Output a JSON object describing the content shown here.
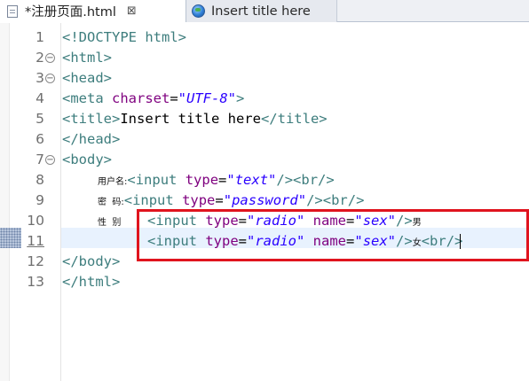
{
  "tabs": [
    {
      "label": "*注册页面.html",
      "close": "⊠",
      "icon": "file-icon",
      "active": true
    },
    {
      "label": "Insert title here",
      "icon": "globe-icon",
      "active": false
    }
  ],
  "editor": {
    "line_numbers": [
      "1",
      "2",
      "3",
      "4",
      "5",
      "6",
      "7",
      "8",
      "9",
      "10",
      "11",
      "12",
      "13"
    ],
    "fold_markers": [
      "2",
      "3",
      "7"
    ],
    "current_line": "11",
    "lines": {
      "l1": {
        "tag": "<!DOCTYPE html>"
      },
      "l2": {
        "tag": "<html>"
      },
      "l3": {
        "tag": "<head>"
      },
      "l4": {
        "open": "<meta",
        "attr": " charset",
        "eq": "=",
        "val": "\"UTF-8\"",
        "close": ">"
      },
      "l5": {
        "open": "<title>",
        "text": "Insert title here",
        "close": "</title>"
      },
      "l6": {
        "tag": "</head>"
      },
      "l7": {
        "tag": "<body>"
      },
      "l8": {
        "label": "用户名:",
        "open": "<input",
        "attr": " type",
        "eq": "=",
        "val": "\"text\"",
        "close": "/><br/>"
      },
      "l9": {
        "label": "密  码:",
        "open": "<input",
        "attr": " type",
        "eq": "=",
        "val": "\"password\"",
        "close": "/><br/>"
      },
      "l10": {
        "label": "性  别",
        "open": "<input",
        "attr": " type",
        "eq": "=",
        "val": "\"radio\"",
        "attr2": " name",
        "eq2": "=",
        "val2": "\"sex\"",
        "close": "/>",
        "after": "男"
      },
      "l11": {
        "open": "<input",
        "attr": " type",
        "eq": "=",
        "val": "\"radio\"",
        "attr2": " name",
        "eq2": "=",
        "val2": "\"sex\"",
        "close": "/>",
        "after": "女",
        "br": "<br/>"
      },
      "l12": {
        "tag": "</body>"
      },
      "l13": {
        "tag": "</html>"
      }
    }
  },
  "annotation_color": "#e0141e",
  "colors": {
    "tag": "#3d7d7d",
    "attribute": "#7f007f",
    "string": "#2a00ff"
  }
}
